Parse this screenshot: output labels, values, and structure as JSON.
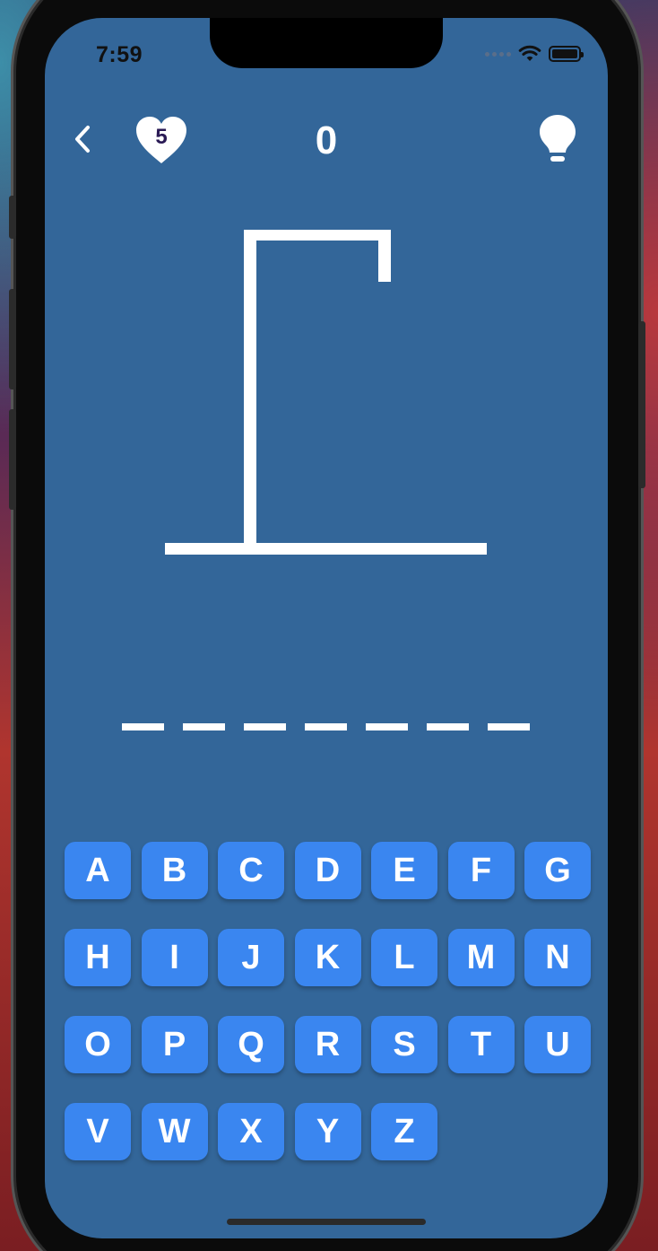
{
  "status_bar": {
    "time": "7:59"
  },
  "header": {
    "lives": "5",
    "score": "0"
  },
  "game": {
    "word_slot_count": 7
  },
  "keyboard": {
    "keys": [
      "A",
      "B",
      "C",
      "D",
      "E",
      "F",
      "G",
      "H",
      "I",
      "J",
      "K",
      "L",
      "M",
      "N",
      "O",
      "P",
      "Q",
      "R",
      "S",
      "T",
      "U",
      "V",
      "W",
      "X",
      "Y",
      "Z"
    ]
  },
  "colors": {
    "screen_background": "#336699",
    "key_background": "#3a86f0",
    "foreground": "#ffffff"
  },
  "icons": {
    "back": "chevron-left-icon",
    "lives": "heart-icon",
    "hint": "lightbulb-icon",
    "wifi": "wifi-icon",
    "battery": "battery-icon"
  }
}
